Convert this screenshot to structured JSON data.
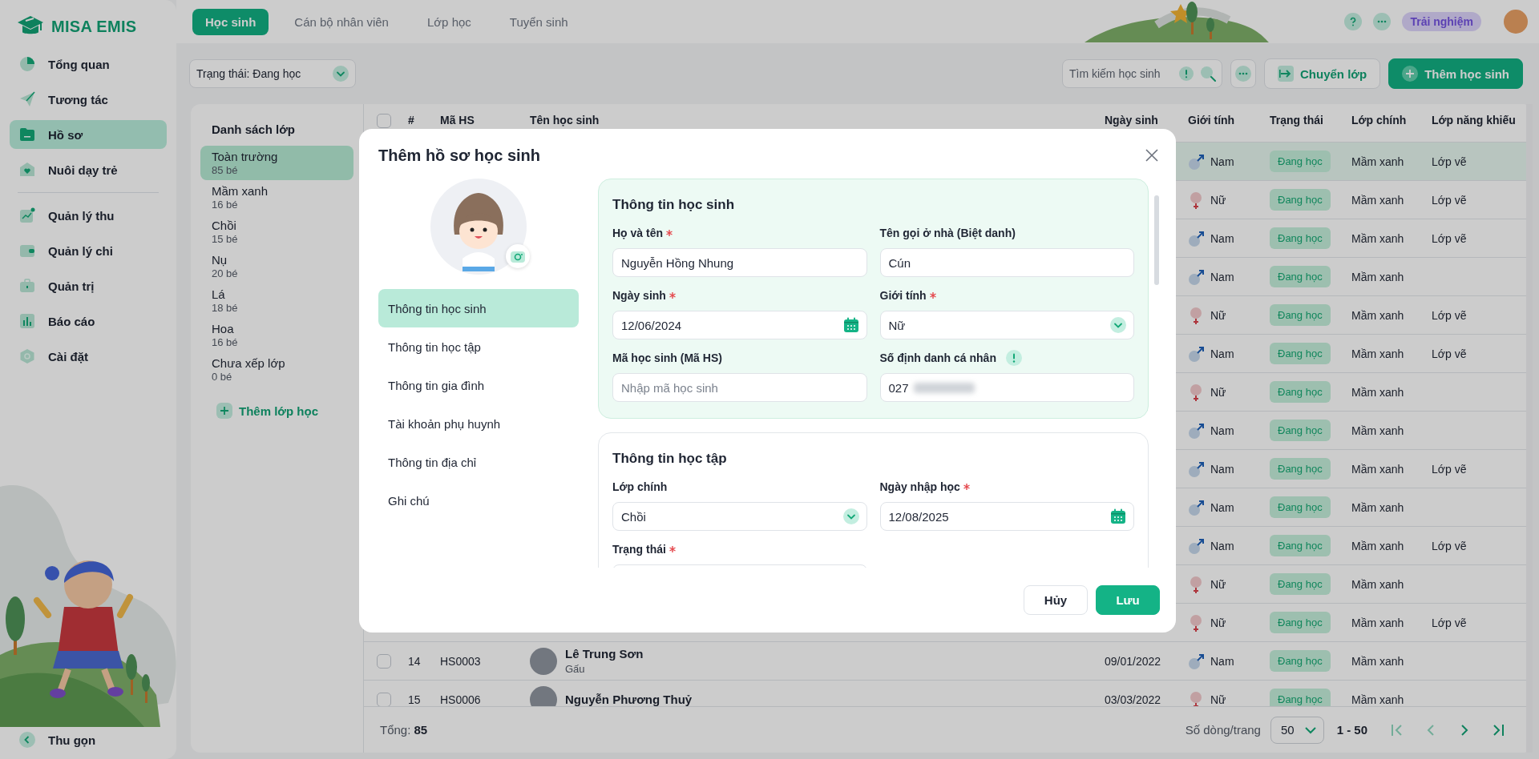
{
  "sidebar": {
    "brand": "MISA EMIS",
    "items": [
      {
        "label": "Tổng quan",
        "selected": false
      },
      {
        "label": "Tương tác",
        "selected": false
      },
      {
        "label": "Hồ sơ",
        "selected": true
      },
      {
        "label": "Nuôi dạy trẻ",
        "selected": false
      },
      {
        "label": "Quản lý thu",
        "selected": false
      },
      {
        "label": "Quản lý chi",
        "selected": false
      },
      {
        "label": "Quản trị",
        "selected": false
      },
      {
        "label": "Báo cáo",
        "selected": false
      },
      {
        "label": "Cài đặt",
        "selected": false
      }
    ],
    "collapse": "Thu gọn"
  },
  "top_tabs": [
    {
      "label": "Học sinh",
      "selected": true
    },
    {
      "label": "Cán bộ nhân viên",
      "selected": false
    },
    {
      "label": "Lớp học",
      "selected": false
    },
    {
      "label": "Tuyển sinh",
      "selected": false
    }
  ],
  "top_actions": {
    "badge": "Trải nghiệm"
  },
  "toolbar": {
    "status_filter": "Trạng thái: Đang học",
    "search_placeholder": "Tìm kiếm học sinh",
    "buttons": [
      {
        "label": "Chuyển lớp",
        "kind": "secondary"
      },
      {
        "label": "Thêm học sinh",
        "kind": "primary"
      }
    ]
  },
  "class_list": {
    "title": "Danh sách lớp",
    "items": [
      {
        "name": "Toàn trường",
        "count": "85 bé",
        "selected": true
      },
      {
        "name": "Mầm xanh",
        "count": "16 bé",
        "selected": false
      },
      {
        "name": "Chồi",
        "count": "15 bé",
        "selected": false
      },
      {
        "name": "Nụ",
        "count": "20 bé",
        "selected": false
      },
      {
        "name": "Lá",
        "count": "18 bé",
        "selected": false
      },
      {
        "name": "Hoa",
        "count": "16 bé",
        "selected": false
      },
      {
        "name": "Chưa xếp lớp",
        "count": "0 bé",
        "selected": false
      }
    ],
    "add_label": "Thêm lớp học"
  },
  "table": {
    "select_all_checked": false,
    "columns": [
      "#",
      "Mã HS",
      "Tên học sinh",
      "Ngày sinh",
      "Giới tính",
      "Trạng thái",
      "Lớp chính",
      "Lớp năng khiếu"
    ],
    "rows": [
      {
        "selected": true,
        "gender": "Nam",
        "kind": "male",
        "status": "Đang học",
        "main_class": "Mầm xanh",
        "talent_class": "Lớp vẽ"
      },
      {
        "selected": false,
        "gender": "Nữ",
        "kind": "female",
        "status": "Đang học",
        "main_class": "Mầm xanh",
        "talent_class": "Lớp vẽ"
      },
      {
        "selected": false,
        "gender": "Nam",
        "kind": "male",
        "status": "Đang học",
        "main_class": "Mầm xanh",
        "talent_class": "Lớp vẽ"
      },
      {
        "selected": false,
        "gender": "Nam",
        "kind": "male",
        "status": "Đang học",
        "main_class": "Mầm xanh"
      },
      {
        "selected": false,
        "gender": "Nữ",
        "kind": "female",
        "status": "Đang học",
        "main_class": "Mầm xanh",
        "talent_class": "Lớp vẽ"
      },
      {
        "selected": false,
        "gender": "Nam",
        "kind": "male",
        "status": "Đang học",
        "main_class": "Mầm xanh",
        "talent_class": "Lớp vẽ"
      },
      {
        "selected": false,
        "gender": "Nữ",
        "kind": "female",
        "status": "Đang học",
        "main_class": "Mầm xanh"
      },
      {
        "selected": false,
        "gender": "Nam",
        "kind": "male",
        "status": "Đang học",
        "main_class": "Mầm xanh"
      },
      {
        "selected": false,
        "gender": "Nam",
        "kind": "male",
        "status": "Đang học",
        "main_class": "Mầm xanh",
        "talent_class": "Lớp vẽ"
      },
      {
        "selected": false,
        "gender": "Nam",
        "kind": "male",
        "status": "Đang học",
        "main_class": "Mầm xanh"
      },
      {
        "selected": false,
        "gender": "Nam",
        "kind": "male",
        "status": "Đang học",
        "main_class": "Mầm xanh",
        "talent_class": "Lớp vẽ"
      },
      {
        "selected": false,
        "gender": "Nữ",
        "kind": "female",
        "status": "Đang học",
        "main_class": "Mầm xanh"
      },
      {
        "selected": false,
        "gender": "Nữ",
        "kind": "female",
        "status": "Đang học",
        "main_class": "Mầm xanh",
        "talent_class": "Lớp vẽ"
      },
      {
        "selected": false,
        "checked": false,
        "number": "14",
        "code": "HS0003",
        "name": "Lê Trung Sơn",
        "nickname": "Gấu",
        "birth_date": "09/01/2022",
        "gender": "Nam",
        "kind": "male",
        "status": "Đang học",
        "main_class": "Mầm xanh"
      },
      {
        "selected": false,
        "checked": false,
        "number": "15",
        "code": "HS0006",
        "name": "Nguyễn Phương Thuỷ",
        "birth_date": "03/03/2022",
        "gender": "Nữ",
        "kind": "female",
        "status": "Đang học",
        "main_class": "Mầm xanh"
      }
    ],
    "footer": {
      "total_label": "Tổng:",
      "total": "85",
      "rows_per_page_label": "Số dòng/trang",
      "rows_per_page": "50",
      "range": "1 - 50",
      "pagination": [
        {
          "kind": "first",
          "disabled": true
        },
        {
          "kind": "prev",
          "disabled": true
        },
        {
          "kind": "next",
          "disabled": false
        },
        {
          "kind": "last",
          "disabled": false
        }
      ]
    }
  },
  "modal": {
    "title": "Thêm hồ sơ học sinh",
    "nav": [
      {
        "label": "Thông tin học sinh",
        "selected": true
      },
      {
        "label": "Thông tin học tập",
        "selected": false
      },
      {
        "label": "Thông tin gia đình",
        "selected": false
      },
      {
        "label": "Tài khoản phụ huynh",
        "selected": false
      },
      {
        "label": "Thông tin địa chỉ",
        "selected": false
      },
      {
        "label": "Ghi chú",
        "selected": false
      }
    ],
    "sections": [
      {
        "title": "Thông tin học sinh",
        "highlighted": true,
        "fields": [
          {
            "label": "Họ và tên",
            "required": true,
            "kind": "text",
            "value": "Nguyễn Hồng Nhung"
          },
          {
            "label": "Tên gọi ở nhà (Biệt danh)",
            "required": false,
            "kind": "text",
            "value": "Cún"
          },
          {
            "label": "Ngày sinh",
            "required": true,
            "kind": "date",
            "value": "12/06/2024"
          },
          {
            "label": "Giới tính",
            "required": true,
            "kind": "select",
            "value": "Nữ"
          },
          {
            "label": "Mã học sinh (Mã HS)",
            "required": false,
            "kind": "text",
            "placeholder": "Nhập mã học sinh"
          },
          {
            "label": "Số định danh cá nhân",
            "required": false,
            "info": true,
            "kind": "text",
            "value": "027",
            "redacted": true
          }
        ]
      },
      {
        "title": "Thông tin học tập",
        "highlighted": false,
        "fields": [
          {
            "label": "Lớp chính",
            "required": false,
            "kind": "select",
            "value": "Chồi"
          },
          {
            "label": "Ngày nhập học",
            "required": true,
            "kind": "date",
            "value": "12/08/2025"
          },
          {
            "label": "Trạng thái",
            "required": true,
            "kind": "text"
          }
        ]
      }
    ],
    "buttons": [
      {
        "label": "Hủy",
        "kind": "secondary"
      },
      {
        "label": "Lưu",
        "kind": "primary"
      }
    ]
  }
}
